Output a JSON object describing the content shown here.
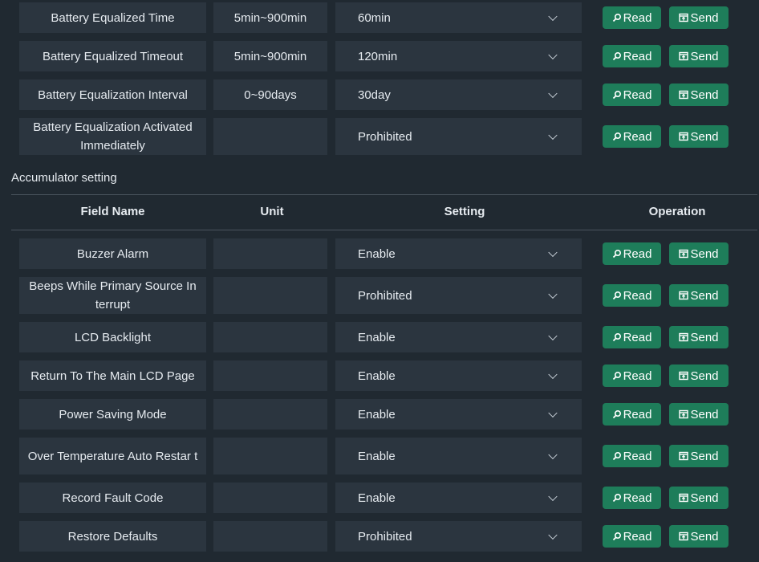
{
  "buttons": {
    "read": "Read",
    "send": "Send"
  },
  "top_rows": [
    {
      "name": "Battery Equalized Time",
      "unit": "5min~900min",
      "setting": "60min"
    },
    {
      "name": "Battery Equalized Timeout",
      "unit": "5min~900min",
      "setting": "120min"
    },
    {
      "name": "Battery Equalization Interval",
      "unit": "0~90days",
      "setting": "30day"
    },
    {
      "name": "Battery Equalization Activated Immediately",
      "unit": "",
      "setting": "Prohibited"
    }
  ],
  "section": {
    "title": "Accumulator setting",
    "headers": {
      "field_name": "Field Name",
      "unit": "Unit",
      "setting": "Setting",
      "operation": "Operation"
    }
  },
  "rows": [
    {
      "name": "Buzzer Alarm",
      "unit": "",
      "setting": "Enable"
    },
    {
      "name": "Beeps While Primary Source In terrupt",
      "unit": "",
      "setting": "Prohibited"
    },
    {
      "name": "LCD Backlight",
      "unit": "",
      "setting": "Enable"
    },
    {
      "name": "Return To The Main LCD Page",
      "unit": "",
      "setting": "Enable"
    },
    {
      "name": "Power Saving Mode",
      "unit": "",
      "setting": "Enable"
    },
    {
      "name": "Over Temperature Auto Restar t",
      "unit": "",
      "setting": "Enable"
    },
    {
      "name": "Record Fault Code",
      "unit": "",
      "setting": "Enable"
    },
    {
      "name": "Restore Defaults",
      "unit": "",
      "setting": "Prohibited"
    }
  ],
  "colors": {
    "background": "#202931",
    "cell": "#2b353f",
    "button": "#1e7d5a",
    "divider": "#4a545e"
  },
  "icons": {
    "read": "search-icon",
    "send": "send-box-icon"
  }
}
